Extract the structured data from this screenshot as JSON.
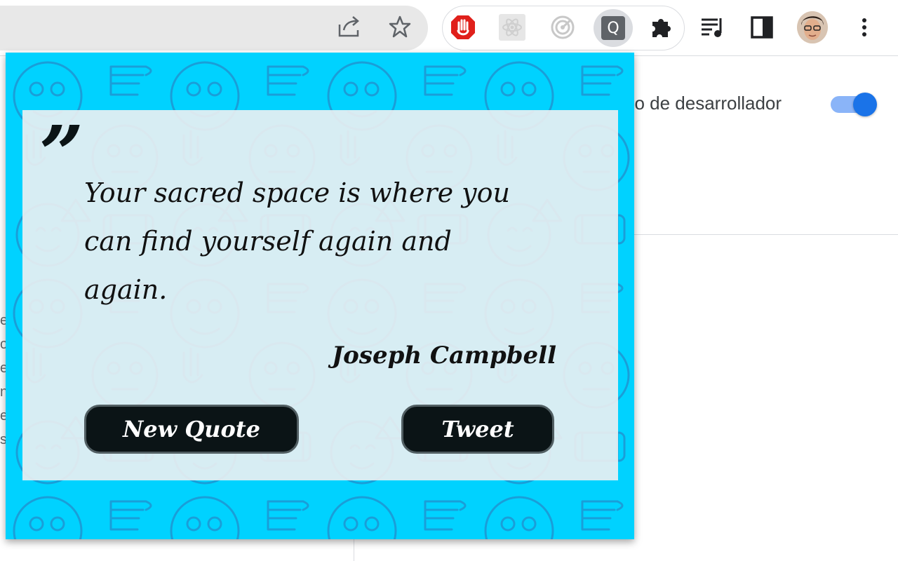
{
  "browser": {
    "toolbar_icons": [
      "share-icon",
      "star-icon",
      "adblock-icon",
      "react-icon",
      "radar-icon",
      "quote-extension-icon",
      "puzzle-icon",
      "media-queue-icon",
      "side-panel-icon",
      "profile-avatar",
      "kebab-menu-icon"
    ],
    "quote_extension_letter": "Q"
  },
  "page": {
    "dev_mode_label": "do de desarrollador",
    "dev_mode_enabled": true,
    "side_letters": [
      "e",
      "o",
      "e",
      "n",
      "e",
      "s"
    ]
  },
  "popup": {
    "quote_mark": "”",
    "quote": "Your sacred space is where you can find yourself again and again.",
    "author": "Joseph Campbell",
    "new_quote_label": "New Quote",
    "tweet_label": "Tweet",
    "colors": {
      "background": "#00d2ff",
      "pattern_stroke": "#1a9ed8",
      "card": "#eef0f2",
      "button": "#0b1416"
    }
  }
}
